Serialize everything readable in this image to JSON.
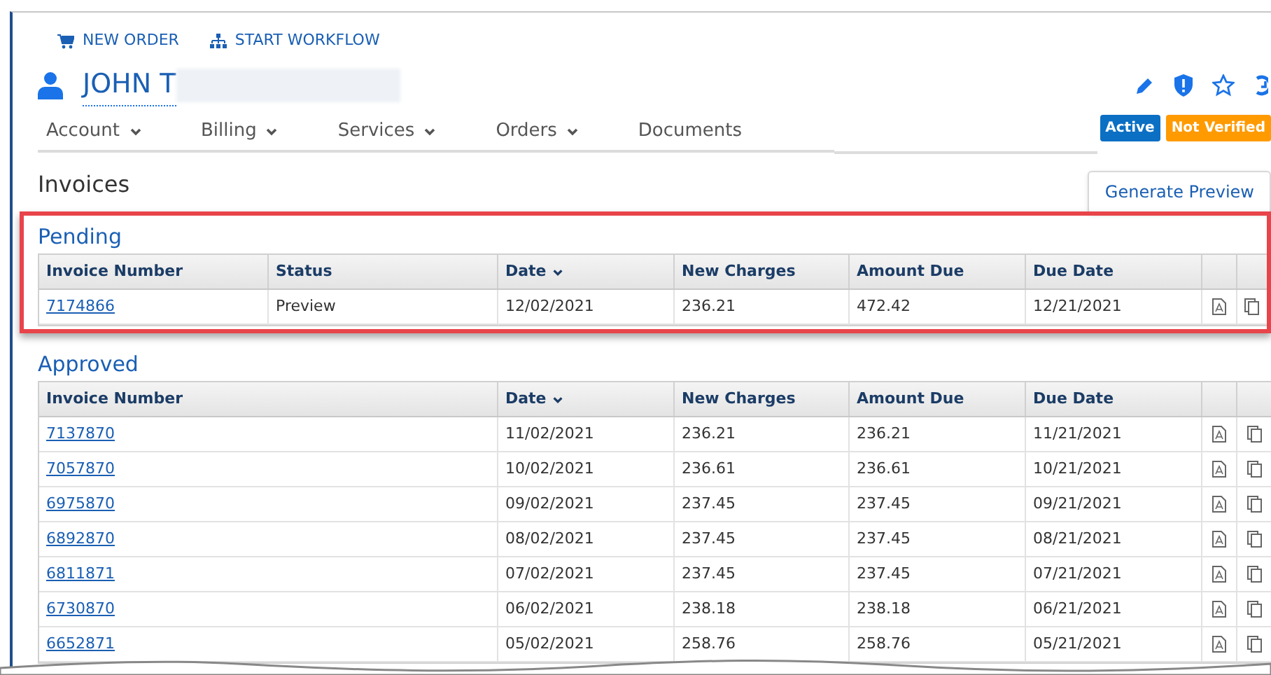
{
  "toolbar": [
    {
      "label": "NEW ORDER",
      "kind": "cart"
    },
    {
      "label": "START WORKFLOW",
      "kind": "workflow"
    }
  ],
  "customer": {
    "name": "JOHN T"
  },
  "nav_tabs": [
    {
      "label": "Account",
      "dropdown": true
    },
    {
      "label": "Billing",
      "dropdown": true
    },
    {
      "label": "Services",
      "dropdown": true
    },
    {
      "label": "Orders",
      "dropdown": true
    },
    {
      "label": "Documents",
      "dropdown": false
    }
  ],
  "badges": [
    {
      "label": "Active",
      "color": "#0b6fc4"
    },
    {
      "label": "Not Verified",
      "color": "#ff9a00"
    }
  ],
  "page_title": "Invoices",
  "generate_button": "Generate Preview",
  "pending": {
    "title": "Pending",
    "highlighted": true,
    "columns": [
      {
        "label": "Invoice Number",
        "sorted": false
      },
      {
        "label": "Status",
        "sorted": false
      },
      {
        "label": "Date",
        "sorted": true
      },
      {
        "label": "New Charges",
        "sorted": false
      },
      {
        "label": "Amount Due",
        "sorted": false
      },
      {
        "label": "Due Date",
        "sorted": false
      }
    ],
    "rows": [
      {
        "cells": [
          "7174866",
          "Preview",
          "12/02/2021",
          "236.21",
          "472.42",
          "12/21/2021"
        ]
      }
    ]
  },
  "approved": {
    "title": "Approved",
    "highlighted": false,
    "columns": [
      {
        "label": "Invoice Number",
        "sorted": false
      },
      {
        "label": "Date",
        "sorted": true
      },
      {
        "label": "New Charges",
        "sorted": false
      },
      {
        "label": "Amount Due",
        "sorted": false
      },
      {
        "label": "Due Date",
        "sorted": false
      }
    ],
    "rows": [
      {
        "cells": [
          "7137870",
          "11/02/2021",
          "236.21",
          "236.21",
          "11/21/2021"
        ]
      },
      {
        "cells": [
          "7057870",
          "10/02/2021",
          "236.61",
          "236.61",
          "10/21/2021"
        ]
      },
      {
        "cells": [
          "6975870",
          "09/02/2021",
          "237.45",
          "237.45",
          "09/21/2021"
        ]
      },
      {
        "cells": [
          "6892870",
          "08/02/2021",
          "237.45",
          "237.45",
          "08/21/2021"
        ]
      },
      {
        "cells": [
          "6811871",
          "07/02/2021",
          "237.45",
          "237.45",
          "07/21/2021"
        ]
      },
      {
        "cells": [
          "6730870",
          "06/02/2021",
          "238.18",
          "238.18",
          "06/21/2021"
        ]
      },
      {
        "cells": [
          "6652871",
          "05/02/2021",
          "258.76",
          "258.76",
          "05/21/2021"
        ]
      }
    ]
  }
}
